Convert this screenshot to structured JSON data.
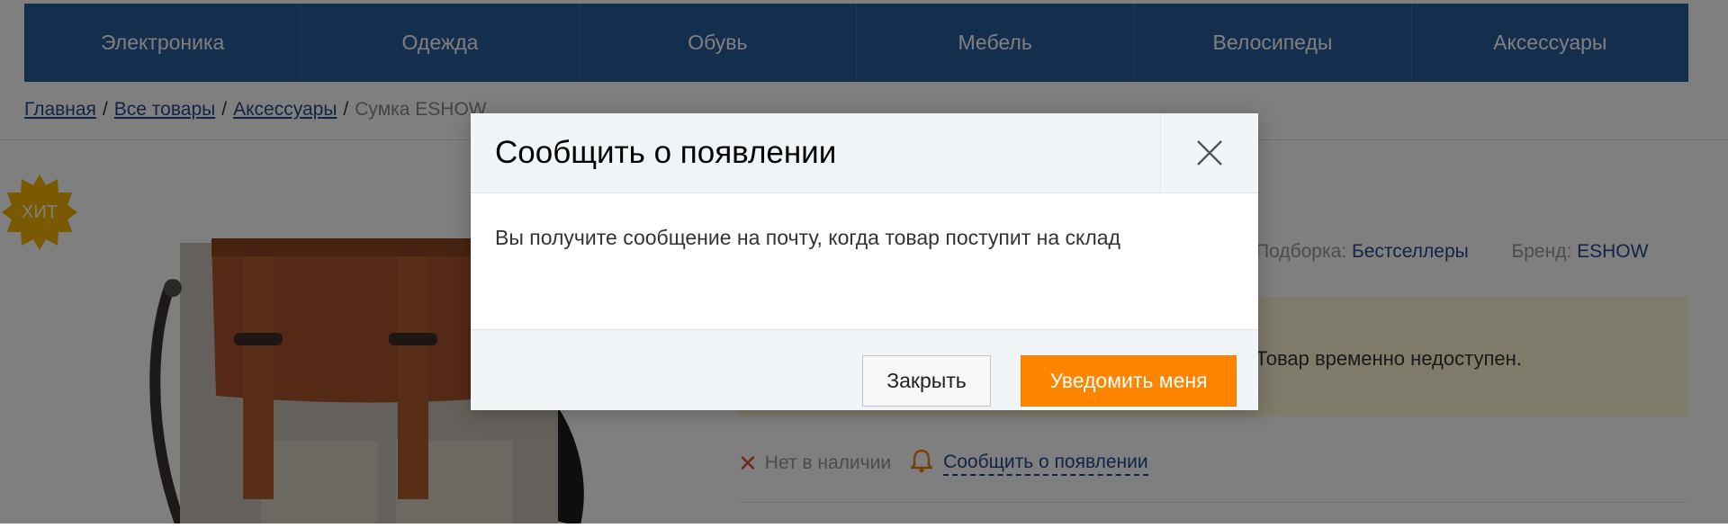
{
  "nav": {
    "items": [
      "Электроника",
      "Одежда",
      "Обувь",
      "Мебель",
      "Велосипеды",
      "Аксессуары"
    ]
  },
  "breadcrumb": {
    "items": [
      "Главная",
      "Все товары",
      "Аксессуары"
    ],
    "current": "Сумка ESHOW",
    "separator": "/"
  },
  "product": {
    "badge": "ХИТ",
    "props": {
      "collection_label": "Подборка:",
      "collection_value": "Бестселлеры",
      "brand_label": "Бренд:",
      "brand_value": "ESHOW"
    },
    "notice": "Товар временно недоступен.",
    "stock": {
      "status": "Нет в наличии",
      "notify_link": "Сообщить о появлении"
    }
  },
  "modal": {
    "title": "Сообщить о появлении",
    "message": "Вы получите сообщение на почту, когда товар поступит на склад",
    "close_button": "Закрыть",
    "notify_button": "Уведомить меня"
  },
  "colors": {
    "nav_bg": "#285c9b",
    "accent_orange": "#ff8400",
    "link_blue": "#24498c",
    "badge_gold": "#f3b400",
    "overlay": "rgba(0,0,0,0.5)"
  }
}
